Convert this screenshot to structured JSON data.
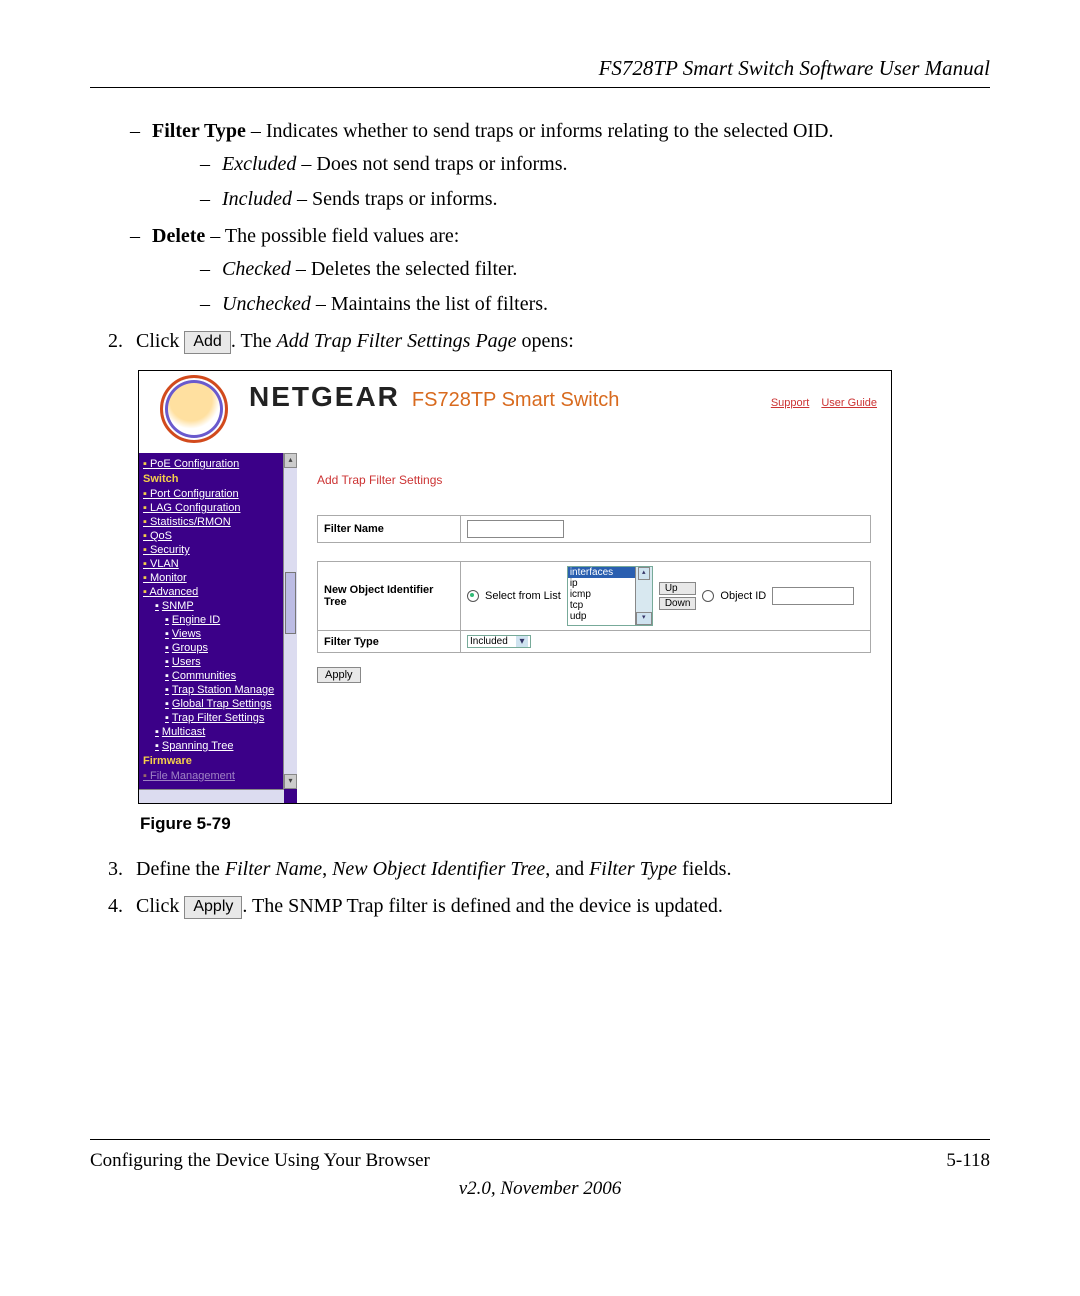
{
  "doc_title": "FS728TP Smart Switch Software User Manual",
  "body": {
    "filter_type_label": "Filter Type",
    "filter_type_desc": " – Indicates whether to send traps or informs relating to the selected OID.",
    "excluded_label": "Excluded",
    "excluded_desc": " – Does not send traps or informs.",
    "included_label": "Included",
    "included_desc": " – Sends traps or informs.",
    "delete_label": "Delete",
    "delete_desc": " – The possible field values are:",
    "checked_label": "Checked",
    "checked_desc": " – Deletes the selected filter.",
    "unchecked_label": "Unchecked",
    "unchecked_desc": " – Maintains the list of filters.",
    "step2_num": "2.",
    "step2_a": "Click ",
    "step2_btn": "Add",
    "step2_b": "The ",
    "step2_ital": "Add Trap Filter Settings Page",
    "step2_c": " opens:",
    "figure_caption": "Figure 5-79",
    "step3_num": "3.",
    "step3_a": "Define the ",
    "step3_i1": "Filter Name",
    "step3_b": ", ",
    "step3_i2": "New Object Identifier Tree",
    "step3_c": ", and ",
    "step3_i3": "Filter Type",
    "step3_d": " fields.",
    "step4_num": "4.",
    "step4_a": "Click ",
    "step4_btn": "Apply",
    "step4_b": ". The SNMP Trap filter is defined and the device is updated."
  },
  "footer": {
    "left": "Configuring the Device Using Your Browser",
    "right": "5-118",
    "version": "v2.0, November 2006"
  },
  "ss": {
    "brand": "NETGEAR",
    "brand_sub": "FS728TP Smart Switch",
    "support": "Support",
    "user_guide": "User Guide",
    "sidebar": {
      "poe": "PoE Configuration",
      "switch": "Switch",
      "portconf": "Port Configuration",
      "lagconf": "LAG Configuration",
      "stats": "Statistics/RMON",
      "qos": "QoS",
      "security": "Security",
      "vlan": "VLAN",
      "monitor": "Monitor",
      "advanced": "Advanced",
      "snmp": "SNMP",
      "engine": "Engine ID",
      "views": "Views",
      "groups": "Groups",
      "users": "Users",
      "communities": "Communities",
      "trapstation": "Trap Station Manage",
      "globaltrap": "Global Trap Settings",
      "trapfilter": "Trap Filter Settings",
      "multicast": "Multicast",
      "spanning": "Spanning Tree",
      "firmware": "Firmware",
      "filemgmt": "File Management"
    },
    "panel": {
      "title": "Add Trap Filter Settings",
      "filter_name": "Filter Name",
      "noit": "New Object Identifier Tree",
      "select_from_list": "Select from List",
      "object_id": "Object ID",
      "up": "Up",
      "down": "Down",
      "list": {
        "i0": "interfaces",
        "i1": "ip",
        "i2": "icmp",
        "i3": "tcp",
        "i4": "udp"
      },
      "filter_type": "Filter Type",
      "filter_type_value": "Included",
      "apply": "Apply"
    }
  }
}
